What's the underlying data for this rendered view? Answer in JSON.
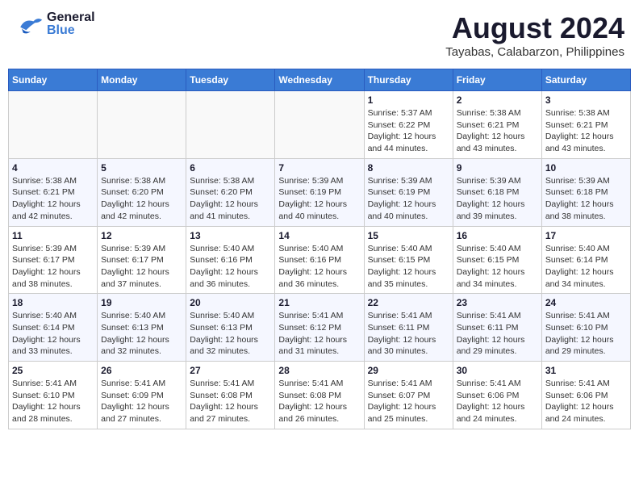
{
  "header": {
    "logo_general": "General",
    "logo_blue": "Blue",
    "title": "August 2024",
    "subtitle": "Tayabas, Calabarzon, Philippines"
  },
  "weekdays": [
    "Sunday",
    "Monday",
    "Tuesday",
    "Wednesday",
    "Thursday",
    "Friday",
    "Saturday"
  ],
  "weeks": [
    [
      {
        "day": "",
        "info": ""
      },
      {
        "day": "",
        "info": ""
      },
      {
        "day": "",
        "info": ""
      },
      {
        "day": "",
        "info": ""
      },
      {
        "day": "1",
        "info": "Sunrise: 5:37 AM\nSunset: 6:22 PM\nDaylight: 12 hours\nand 44 minutes."
      },
      {
        "day": "2",
        "info": "Sunrise: 5:38 AM\nSunset: 6:21 PM\nDaylight: 12 hours\nand 43 minutes."
      },
      {
        "day": "3",
        "info": "Sunrise: 5:38 AM\nSunset: 6:21 PM\nDaylight: 12 hours\nand 43 minutes."
      }
    ],
    [
      {
        "day": "4",
        "info": "Sunrise: 5:38 AM\nSunset: 6:21 PM\nDaylight: 12 hours\nand 42 minutes."
      },
      {
        "day": "5",
        "info": "Sunrise: 5:38 AM\nSunset: 6:20 PM\nDaylight: 12 hours\nand 42 minutes."
      },
      {
        "day": "6",
        "info": "Sunrise: 5:38 AM\nSunset: 6:20 PM\nDaylight: 12 hours\nand 41 minutes."
      },
      {
        "day": "7",
        "info": "Sunrise: 5:39 AM\nSunset: 6:19 PM\nDaylight: 12 hours\nand 40 minutes."
      },
      {
        "day": "8",
        "info": "Sunrise: 5:39 AM\nSunset: 6:19 PM\nDaylight: 12 hours\nand 40 minutes."
      },
      {
        "day": "9",
        "info": "Sunrise: 5:39 AM\nSunset: 6:18 PM\nDaylight: 12 hours\nand 39 minutes."
      },
      {
        "day": "10",
        "info": "Sunrise: 5:39 AM\nSunset: 6:18 PM\nDaylight: 12 hours\nand 38 minutes."
      }
    ],
    [
      {
        "day": "11",
        "info": "Sunrise: 5:39 AM\nSunset: 6:17 PM\nDaylight: 12 hours\nand 38 minutes."
      },
      {
        "day": "12",
        "info": "Sunrise: 5:39 AM\nSunset: 6:17 PM\nDaylight: 12 hours\nand 37 minutes."
      },
      {
        "day": "13",
        "info": "Sunrise: 5:40 AM\nSunset: 6:16 PM\nDaylight: 12 hours\nand 36 minutes."
      },
      {
        "day": "14",
        "info": "Sunrise: 5:40 AM\nSunset: 6:16 PM\nDaylight: 12 hours\nand 36 minutes."
      },
      {
        "day": "15",
        "info": "Sunrise: 5:40 AM\nSunset: 6:15 PM\nDaylight: 12 hours\nand 35 minutes."
      },
      {
        "day": "16",
        "info": "Sunrise: 5:40 AM\nSunset: 6:15 PM\nDaylight: 12 hours\nand 34 minutes."
      },
      {
        "day": "17",
        "info": "Sunrise: 5:40 AM\nSunset: 6:14 PM\nDaylight: 12 hours\nand 34 minutes."
      }
    ],
    [
      {
        "day": "18",
        "info": "Sunrise: 5:40 AM\nSunset: 6:14 PM\nDaylight: 12 hours\nand 33 minutes."
      },
      {
        "day": "19",
        "info": "Sunrise: 5:40 AM\nSunset: 6:13 PM\nDaylight: 12 hours\nand 32 minutes."
      },
      {
        "day": "20",
        "info": "Sunrise: 5:40 AM\nSunset: 6:13 PM\nDaylight: 12 hours\nand 32 minutes."
      },
      {
        "day": "21",
        "info": "Sunrise: 5:41 AM\nSunset: 6:12 PM\nDaylight: 12 hours\nand 31 minutes."
      },
      {
        "day": "22",
        "info": "Sunrise: 5:41 AM\nSunset: 6:11 PM\nDaylight: 12 hours\nand 30 minutes."
      },
      {
        "day": "23",
        "info": "Sunrise: 5:41 AM\nSunset: 6:11 PM\nDaylight: 12 hours\nand 29 minutes."
      },
      {
        "day": "24",
        "info": "Sunrise: 5:41 AM\nSunset: 6:10 PM\nDaylight: 12 hours\nand 29 minutes."
      }
    ],
    [
      {
        "day": "25",
        "info": "Sunrise: 5:41 AM\nSunset: 6:10 PM\nDaylight: 12 hours\nand 28 minutes."
      },
      {
        "day": "26",
        "info": "Sunrise: 5:41 AM\nSunset: 6:09 PM\nDaylight: 12 hours\nand 27 minutes."
      },
      {
        "day": "27",
        "info": "Sunrise: 5:41 AM\nSunset: 6:08 PM\nDaylight: 12 hours\nand 27 minutes."
      },
      {
        "day": "28",
        "info": "Sunrise: 5:41 AM\nSunset: 6:08 PM\nDaylight: 12 hours\nand 26 minutes."
      },
      {
        "day": "29",
        "info": "Sunrise: 5:41 AM\nSunset: 6:07 PM\nDaylight: 12 hours\nand 25 minutes."
      },
      {
        "day": "30",
        "info": "Sunrise: 5:41 AM\nSunset: 6:06 PM\nDaylight: 12 hours\nand 24 minutes."
      },
      {
        "day": "31",
        "info": "Sunrise: 5:41 AM\nSunset: 6:06 PM\nDaylight: 12 hours\nand 24 minutes."
      }
    ]
  ]
}
